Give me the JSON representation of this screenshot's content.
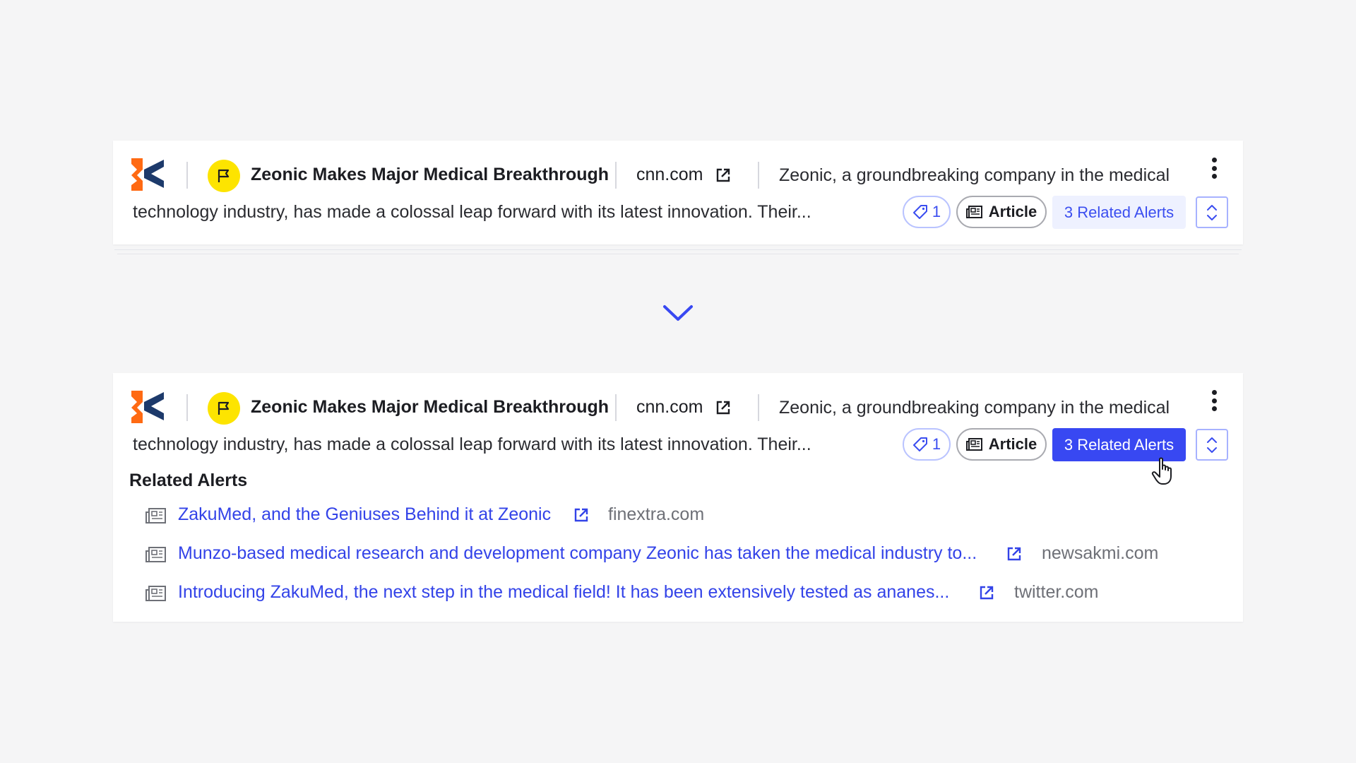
{
  "colors": {
    "accent": "#3848f2",
    "link": "#3343e8",
    "flag_badge": "#fde400",
    "logo_orange": "#ff6a13",
    "logo_navy": "#1d3a6b"
  },
  "alert": {
    "icon": "flag-icon",
    "title": "Zeonic Makes Major Medical Breakthrough",
    "source": "cnn.com",
    "snippet_line1": "Zeonic, a groundbreaking company in the medical",
    "snippet_line2": "technology industry, has made a colossal leap forward with its  latest innovation. Their...",
    "tag_count": "1",
    "type_label": "Article",
    "related_button_label": "3 Related Alerts"
  },
  "transition_icon": "chevron-down-icon",
  "related": {
    "heading": "Related Alerts",
    "items": [
      {
        "title": "ZakuMed, and the Geniuses Behind it at Zeonic",
        "source": "finextra.com"
      },
      {
        "title": "Munzo-based medical research and development company Zeonic has taken the medical industry to...",
        "source": "newsakmi.com"
      },
      {
        "title": "Introducing ZakuMed, the next step in the medical field! It has been extensively tested as ananes...",
        "source": "twitter.com"
      }
    ]
  }
}
